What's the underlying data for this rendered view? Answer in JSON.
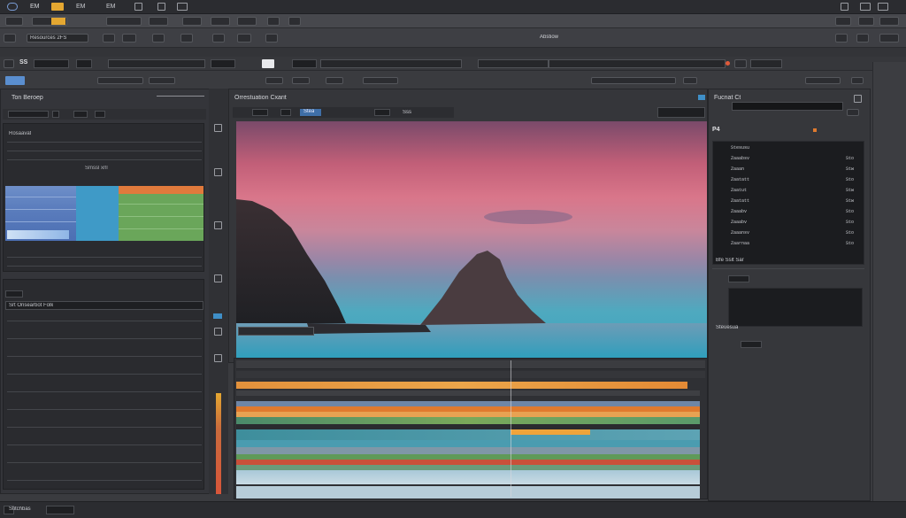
{
  "menubar": {
    "items": [
      "SS",
      "EM",
      "EM",
      "EM",
      "EM",
      "EM",
      "EM"
    ]
  },
  "toolbar": {
    "preset_label": "Resources 2FS",
    "center_title": "Abstiow",
    "mode_label": "SS"
  },
  "project_panel": {
    "title": "Ton Beroep",
    "section_label": "Rosaavat",
    "item_label": "Smssl xrll",
    "sub_label": "Srt Onsearbot Folk",
    "footer_label": "Stitchbas"
  },
  "viewer": {
    "title": "Orrestuation Cxarit",
    "zoom_label": "Stea",
    "timecode_label": "Sss"
  },
  "inspector": {
    "title": "Fucnat Ct",
    "section_label": "P4",
    "rows": [
      "Stesusu",
      "Zaaabsv",
      "Zaaan",
      "Zaatatt",
      "Zaatut",
      "Zaatatt",
      "Zaaabv",
      "Zaaabv",
      "Zaaansv",
      "Zaarnaa"
    ],
    "values": [
      "Sto",
      "Stw",
      "Sto",
      "Stw",
      "Stw",
      "Sto",
      "Sto",
      "Sto",
      "Sto"
    ],
    "footer_label": "Bfe Sslt Sar",
    "bottom_label": "Steuesua"
  },
  "colors": {
    "background": "#3a3b3f",
    "panel": "#34353a",
    "accent_orange": "#e07a2e",
    "accent_blue": "#4f8fd8",
    "clip_green": "#6aaa5a",
    "clip_teal": "#3f8f9c"
  }
}
